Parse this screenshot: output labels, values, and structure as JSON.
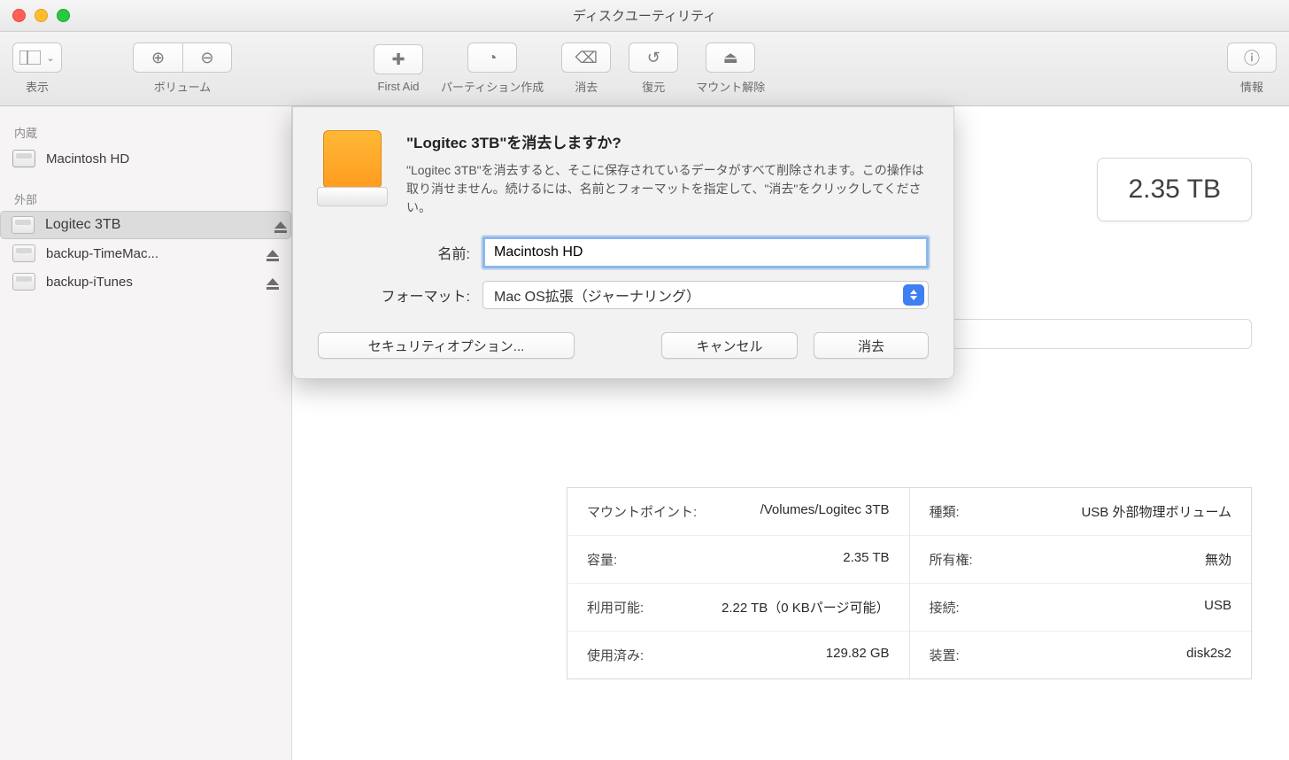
{
  "window": {
    "title": "ディスクユーティリティ"
  },
  "toolbar": {
    "view": "表示",
    "volume": "ボリューム",
    "first_aid": "First Aid",
    "partition": "パーティション作成",
    "erase": "消去",
    "restore": "復元",
    "unmount": "マウント解除",
    "info": "情報"
  },
  "sidebar": {
    "internal_header": "内蔵",
    "external_header": "外部",
    "internal": [
      {
        "name": "Macintosh HD"
      }
    ],
    "external": [
      {
        "name": "Logitec 3TB",
        "selected": true
      },
      {
        "name": "backup-TimeMac..."
      },
      {
        "name": "backup-iTunes"
      }
    ]
  },
  "main": {
    "capacity_chip": "2.35 TB",
    "info_left": [
      {
        "label": "マウントポイント:",
        "value": "/Volumes/Logitec 3TB"
      },
      {
        "label": "容量:",
        "value": "2.35 TB"
      },
      {
        "label": "利用可能:",
        "value": "2.22 TB（0 KBパージ可能）"
      },
      {
        "label": "使用済み:",
        "value": "129.82 GB"
      }
    ],
    "info_right": [
      {
        "label": "種類:",
        "value": "USB 外部物理ボリューム"
      },
      {
        "label": "所有権:",
        "value": "無効"
      },
      {
        "label": "接続:",
        "value": "USB"
      },
      {
        "label": "装置:",
        "value": "disk2s2"
      }
    ]
  },
  "dialog": {
    "title": "\"Logitec 3TB\"を消去しますか?",
    "description": "\"Logitec 3TB\"を消去すると、そこに保存されているデータがすべて削除されます。この操作は取り消せません。続けるには、名前とフォーマットを指定して、\"消去\"をクリックしてください。",
    "name_label": "名前:",
    "name_value": "Macintosh HD",
    "format_label": "フォーマット:",
    "format_value": "Mac OS拡張（ジャーナリング）",
    "security_btn": "セキュリティオプション...",
    "cancel_btn": "キャンセル",
    "erase_btn": "消去"
  }
}
